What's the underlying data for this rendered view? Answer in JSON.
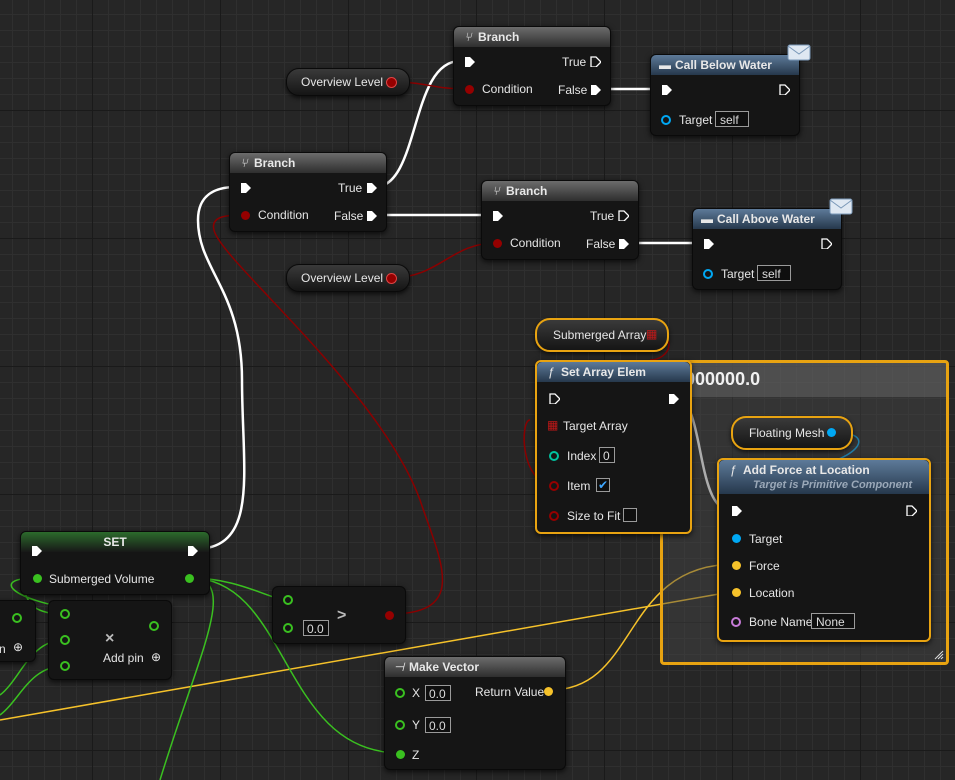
{
  "comment": {
    "title": "1000000.0"
  },
  "nodes": {
    "branch_top": {
      "title": "Branch",
      "true_label": "True",
      "condition_label": "Condition",
      "false_label": "False"
    },
    "branch_mid": {
      "title": "Branch",
      "true_label": "True",
      "condition_label": "Condition",
      "false_label": "False"
    },
    "branch_low": {
      "title": "Branch",
      "true_label": "True",
      "condition_label": "Condition",
      "false_label": "False"
    },
    "call_below": {
      "title": "Call Below Water",
      "target_label": "Target",
      "target_value": "self"
    },
    "call_above": {
      "title": "Call Above Water",
      "target_label": "Target",
      "target_value": "self"
    },
    "overview_level_1": {
      "label": "Overview Level"
    },
    "overview_level_2": {
      "label": "Overview Level"
    },
    "submerged_array": {
      "label": "Submerged Array"
    },
    "set_array_elem": {
      "title": "Set Array Elem",
      "target_array_label": "Target Array",
      "index_label": "Index",
      "index_value": "0",
      "item_label": "Item",
      "size_to_fit_label": "Size to Fit"
    },
    "floating_mesh": {
      "label": "Floating Mesh"
    },
    "add_force": {
      "title": "Add Force at Location",
      "subtitle": "Target is Primitive Component",
      "target_label": "Target",
      "force_label": "Force",
      "location_label": "Location",
      "bone_name_label": "Bone Name",
      "bone_name_value": "None"
    },
    "set_node": {
      "title": "SET",
      "var_label": "Submerged Volume"
    },
    "compare": {
      "op": ">",
      "value": "0.0"
    },
    "add_node": {
      "partial_label": "n",
      "add_pin_label": "Add pin",
      "op_symbol": "×"
    },
    "make_vector": {
      "title": "Make Vector",
      "x_label": "X",
      "x_value": "0.0",
      "y_label": "Y",
      "y_value": "0.0",
      "z_label": "Z",
      "return_label": "Return Value"
    }
  },
  "colors": {
    "exec": "#ffffff",
    "bool": "#950000",
    "float": "#3ac020",
    "vector": "#f6c22a",
    "object": "#00a8f4",
    "name": "#c77bd8",
    "selection": "#e8a311"
  },
  "icons": {
    "branch": "branch-icon",
    "function": "function-icon",
    "event": "envelope-icon",
    "make": "make-vector-icon"
  }
}
